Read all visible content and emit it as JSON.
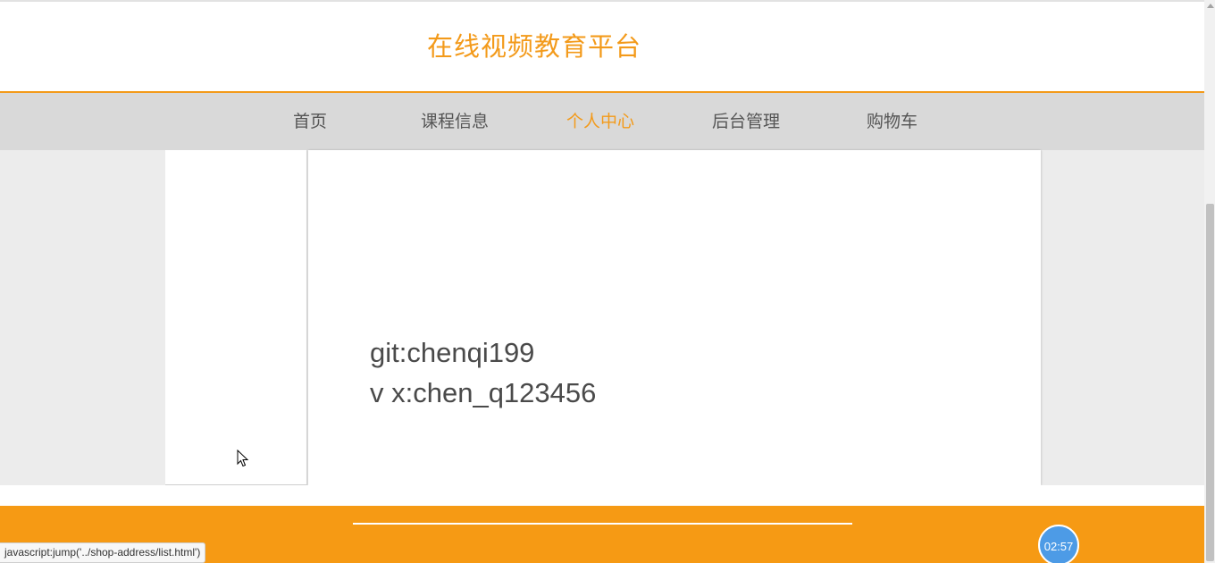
{
  "header": {
    "site_title": "在线视频教育平台"
  },
  "nav": {
    "items": [
      {
        "label": "首页",
        "active": false
      },
      {
        "label": "课程信息",
        "active": false
      },
      {
        "label": "个人中心",
        "active": true
      },
      {
        "label": "后台管理",
        "active": false
      },
      {
        "label": "购物车",
        "active": false
      }
    ]
  },
  "main": {
    "info_lines": [
      "git:chenqi199",
      "v x:chen_q123456"
    ]
  },
  "status_bar": {
    "url": "javascript:jump('../shop-address/list.html')"
  },
  "timer": {
    "value": "02:57"
  },
  "colors": {
    "accent": "#f39a1a",
    "footer": "#f69a14",
    "nav_background": "#d9d9d9",
    "content_background": "#ececec",
    "timer_badge": "#4d9be6"
  }
}
